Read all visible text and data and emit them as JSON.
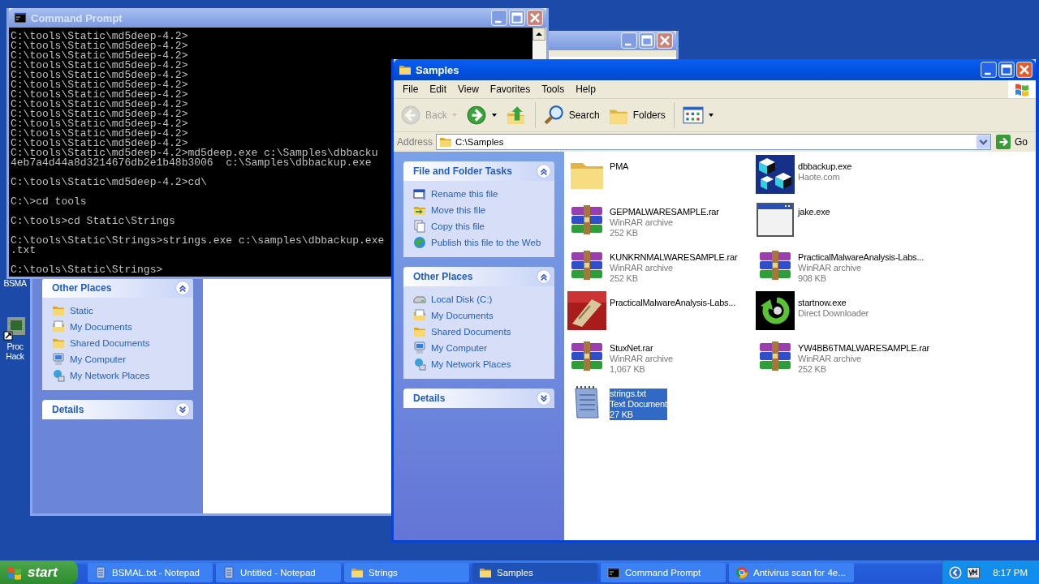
{
  "desktop": {
    "icons": [
      {
        "kind": "text",
        "lines": [
          "BSMA"
        ]
      },
      {
        "kind": "program",
        "lines": [
          "Proc",
          "Hack"
        ]
      }
    ]
  },
  "strings_window": {
    "panels": [
      {
        "title": "Other Places",
        "expanded": true,
        "items": [
          {
            "label": "Static",
            "kind": "folder"
          },
          {
            "label": "My Documents",
            "kind": "documents"
          },
          {
            "label": "Shared Documents",
            "kind": "folder"
          },
          {
            "label": "My Computer",
            "kind": "computer"
          },
          {
            "label": "My Network Places",
            "kind": "network"
          }
        ]
      },
      {
        "title": "Details",
        "expanded": false
      }
    ]
  },
  "command_prompt": {
    "title": "Command Prompt",
    "blocks": [
      [
        "C:\\tools\\Static\\md5deep-4.2>",
        "C:\\tools\\Static\\md5deep-4.2>",
        "C:\\tools\\Static\\md5deep-4.2>",
        "C:\\tools\\Static\\md5deep-4.2>",
        "C:\\tools\\Static\\md5deep-4.2>",
        "C:\\tools\\Static\\md5deep-4.2>",
        "C:\\tools\\Static\\md5deep-4.2>",
        "C:\\tools\\Static\\md5deep-4.2>",
        "C:\\tools\\Static\\md5deep-4.2>",
        "C:\\tools\\Static\\md5deep-4.2>",
        "C:\\tools\\Static\\md5deep-4.2>",
        "C:\\tools\\Static\\md5deep-4.2>",
        "C:\\tools\\Static\\md5deep-4.2>md5deep.exe c:\\Samples\\dbbacku",
        "4eb7a4d44a8d3214676db2e1b48b3006  c:\\Samples\\dbbackup.exe"
      ],
      [
        "C:\\tools\\Static\\md5deep-4.2>cd\\"
      ],
      [
        "C:\\>cd tools"
      ],
      [
        "C:\\tools>cd Static\\Strings"
      ],
      [
        "C:\\tools\\Static\\Strings>strings.exe c:\\samples\\dbbackup.exe",
        ".txt"
      ],
      [
        "C:\\tools\\Static\\Strings>"
      ]
    ]
  },
  "samples_window": {
    "title": "Samples",
    "menu": [
      "File",
      "Edit",
      "View",
      "Favorites",
      "Tools",
      "Help"
    ],
    "toolbar": [
      {
        "kind": "back",
        "label": "Back",
        "disabled": true
      },
      {
        "kind": "forward",
        "disabled": false
      },
      {
        "kind": "up",
        "disabled": false
      },
      {
        "kind": "search",
        "label": "Search",
        "disabled": false
      },
      {
        "kind": "folders",
        "label": "Folders",
        "disabled": false
      },
      {
        "kind": "views",
        "disabled": false
      }
    ],
    "address": {
      "label": "Address",
      "value": "C:\\Samples",
      "go": "Go"
    },
    "panels": [
      {
        "title": "File and Folder Tasks",
        "expanded": true,
        "items": [
          {
            "label": "Rename this file",
            "kind": "rename"
          },
          {
            "label": "Move this file",
            "kind": "move"
          },
          {
            "label": "Copy this file",
            "kind": "copy"
          },
          {
            "label": "Publish this file to the Web",
            "kind": "publish"
          }
        ]
      },
      {
        "title": "Other Places",
        "expanded": true,
        "items": [
          {
            "label": "Local Disk (C:)",
            "kind": "disk"
          },
          {
            "label": "My Documents",
            "kind": "documents"
          },
          {
            "label": "Shared Documents",
            "kind": "folder"
          },
          {
            "label": "My Computer",
            "kind": "computer"
          },
          {
            "label": "My Network Places",
            "kind": "network"
          }
        ]
      },
      {
        "title": "Details",
        "expanded": false
      }
    ],
    "files": [
      {
        "name": "PMA",
        "kind": "folder",
        "selected": false
      },
      {
        "name": "dbbackup.exe",
        "kind": "cubes",
        "selected": false,
        "lines": [
          "Haote.com"
        ]
      },
      {
        "name": "GEPMALWARESAMPLE.rar",
        "kind": "archive",
        "selected": false,
        "lines": [
          "WinRAR archive",
          "252 KB"
        ]
      },
      {
        "name": "jake.exe",
        "kind": "window",
        "selected": false
      },
      {
        "name": "KUNKRNMALWARESAMPLE.rar",
        "kind": "archive",
        "selected": false,
        "lines": [
          "WinRAR archive",
          "252 KB"
        ]
      },
      {
        "name": "PracticalMalwareAnalysis-Labs...",
        "kind": "archive",
        "selected": false,
        "lines": [
          "WinRAR archive",
          "908 KB"
        ]
      },
      {
        "name": "PracticalMalwareAnalysis-Labs...",
        "kind": "thumbnail",
        "selected": false
      },
      {
        "name": "startnow.exe",
        "kind": "arrow",
        "selected": false,
        "lines": [
          "Direct Downloader"
        ]
      },
      {
        "name": "StuxNet.rar",
        "kind": "archive",
        "selected": false,
        "lines": [
          "WinRAR archive",
          "1,067 KB"
        ]
      },
      {
        "name": "YW4BB6TMALWARESAMPLE.rar",
        "kind": "archive",
        "selected": false,
        "lines": [
          "WinRAR archive",
          "252 KB"
        ]
      },
      {
        "name": "strings.txt",
        "kind": "notepad",
        "selected": true,
        "lines": [
          "Text Document",
          "27 KB"
        ]
      }
    ]
  },
  "taskbar": {
    "start": "start",
    "buttons": [
      {
        "label": "BSMAL.txt - Notepad",
        "kind": "notepad",
        "selected": false
      },
      {
        "label": "Untitled - Notepad",
        "kind": "notepad",
        "selected": false
      },
      {
        "label": "Strings",
        "kind": "folder",
        "selected": false
      },
      {
        "label": "Samples",
        "kind": "folder",
        "selected": true
      },
      {
        "label": "Command Prompt",
        "kind": "console",
        "selected": false
      },
      {
        "label": "Antivirus scan for 4e...",
        "kind": "browser",
        "selected": false
      }
    ],
    "clock": "8:17 PM"
  }
}
